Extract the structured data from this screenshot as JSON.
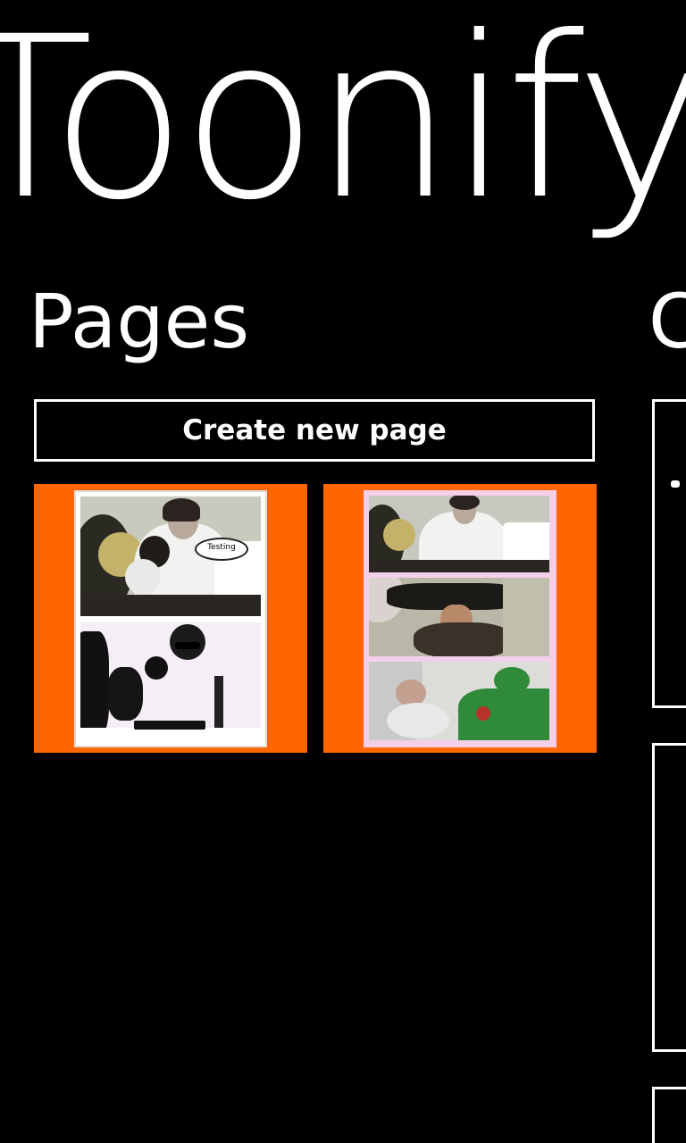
{
  "app": {
    "title": "Toonify"
  },
  "sections": {
    "pages_header": "Pages",
    "next_header_partial": "C"
  },
  "actions": {
    "create_new_page": "Create new page"
  },
  "pages": [
    {
      "panels": 2,
      "bubble_text": "Testing"
    },
    {
      "panels": 3
    }
  ],
  "colors": {
    "accent": "#FF6600",
    "background": "#000000",
    "foreground": "#FFFFFF"
  }
}
